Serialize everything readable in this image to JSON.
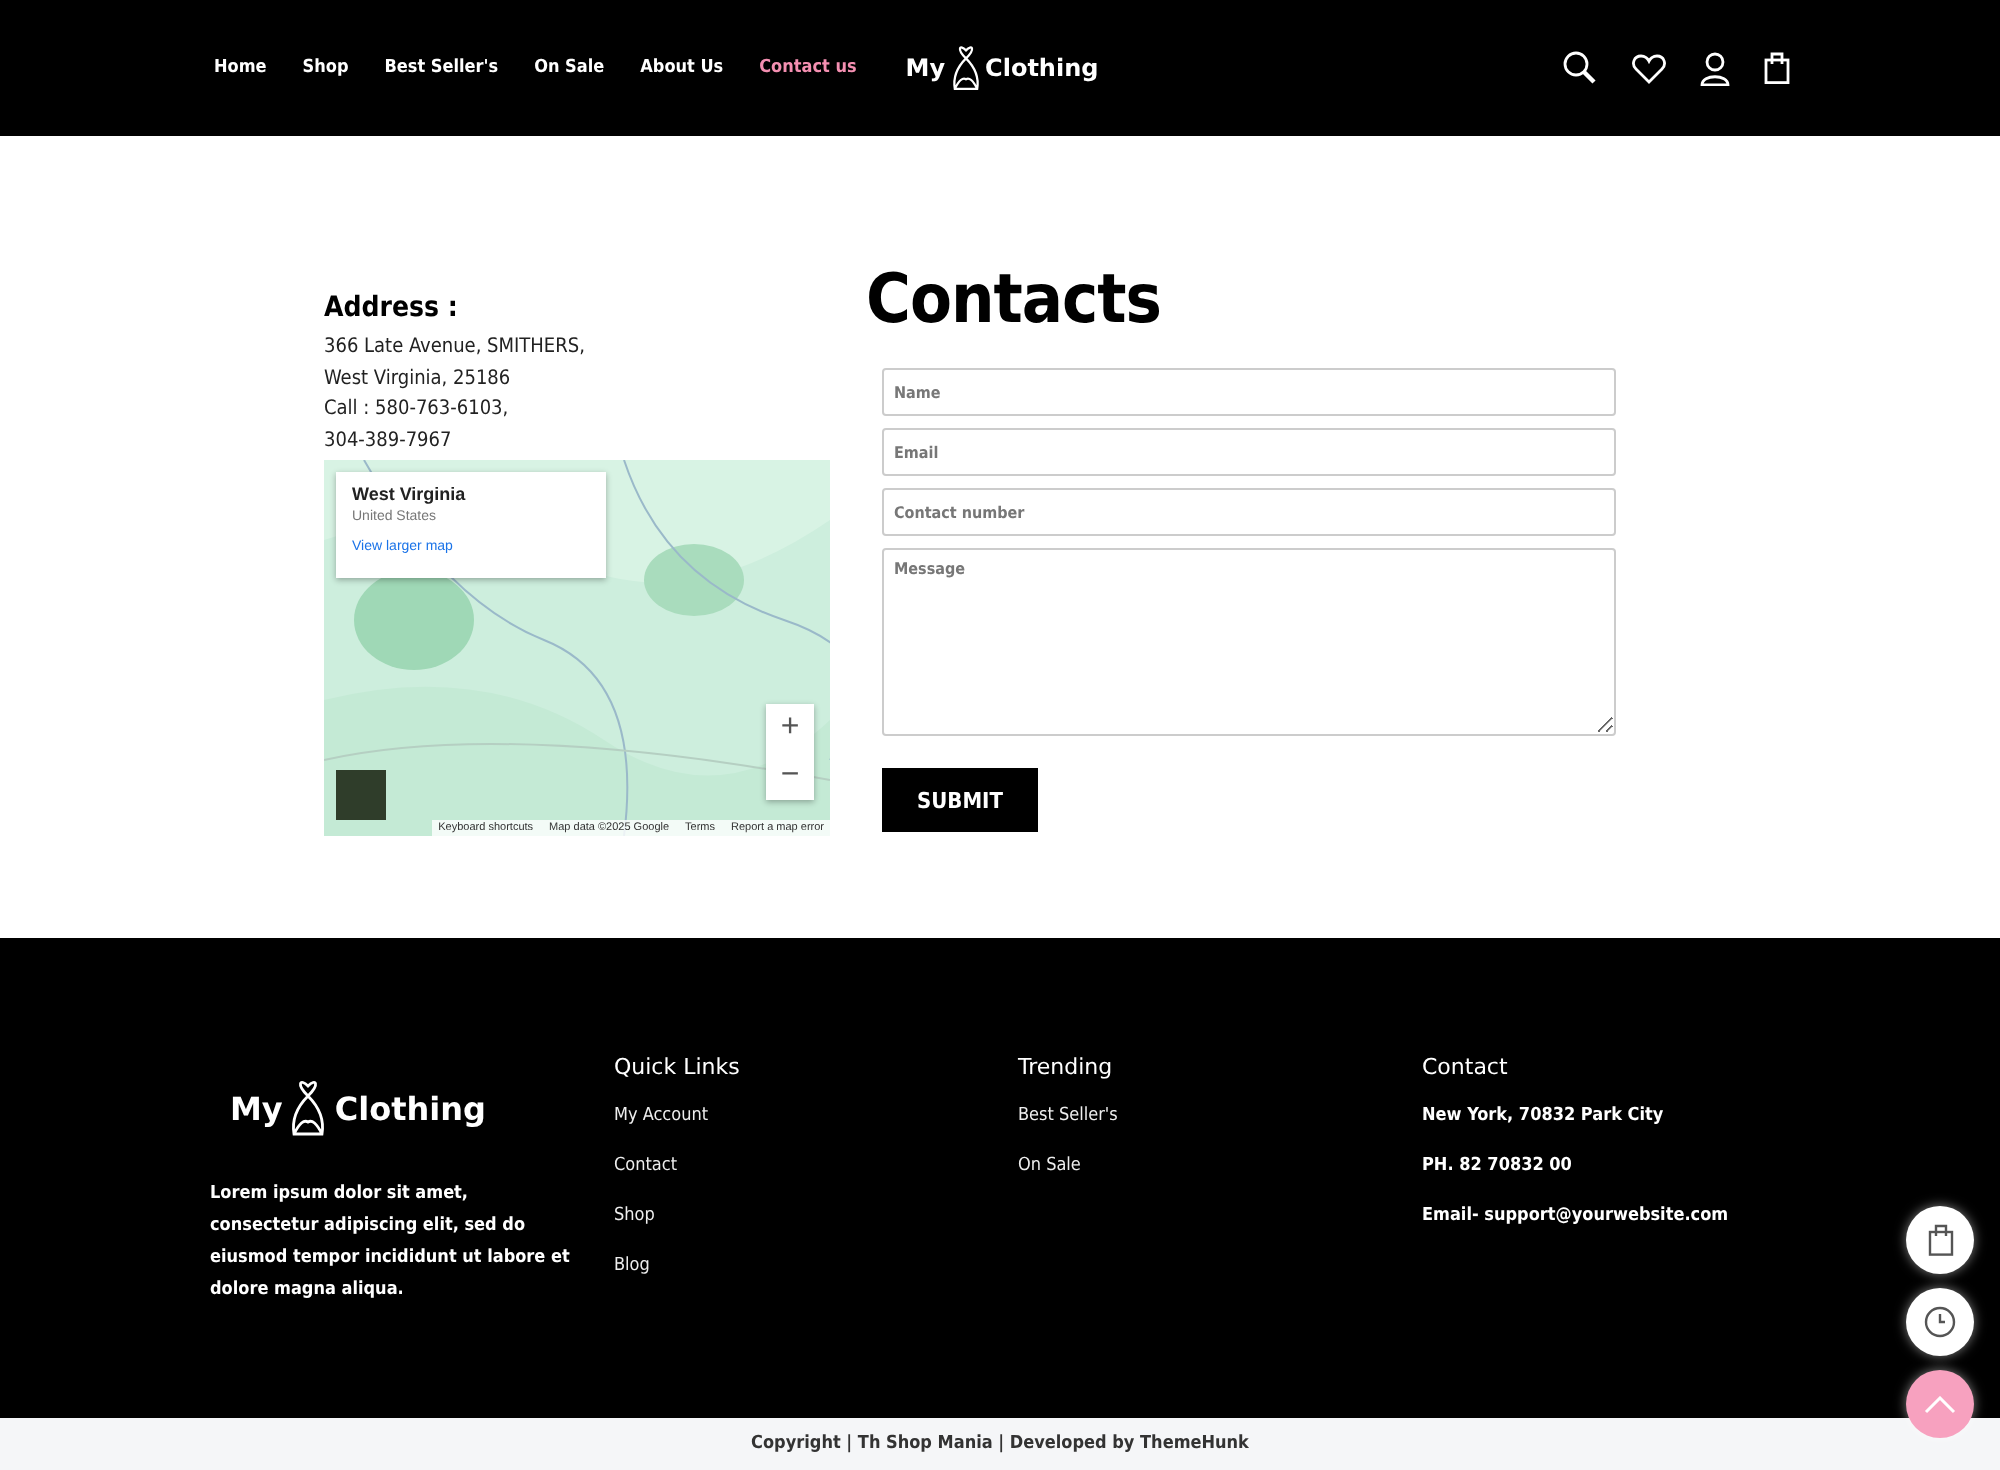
{
  "nav": [
    {
      "label": "Home",
      "selected": false
    },
    {
      "label": "Shop",
      "selected": false
    },
    {
      "label": "Best Seller's",
      "selected": false
    },
    {
      "label": "On Sale",
      "selected": false
    },
    {
      "label": "About Us",
      "selected": false
    },
    {
      "label": "Contact us",
      "selected": true
    }
  ],
  "logo": {
    "left": "My",
    "right": "Clothing"
  },
  "address": {
    "heading": "Address :",
    "lines": [
      " 366 Late Avenue, SMITHERS,",
      "West Virginia, 25186",
      "Call : 580-763-6103,",
      "304-389-7967"
    ]
  },
  "map": {
    "kind": "picture",
    "card_title": "West Virginia",
    "card_subtitle": "United States",
    "card_link": "View larger map",
    "zoom_in": "+",
    "zoom_out": "−",
    "attribution": [
      "Keyboard shortcuts",
      "Map data ©2025 Google",
      "Terms",
      "Report a map error"
    ]
  },
  "form": {
    "title": "Contacts",
    "fields": [
      {
        "placeholder": "Name",
        "kind": "input"
      },
      {
        "placeholder": "Email",
        "kind": "input"
      },
      {
        "placeholder": "Contact number",
        "kind": "input"
      },
      {
        "placeholder": "Message",
        "kind": "textarea"
      }
    ],
    "submit": "SUBMIT"
  },
  "footer": {
    "logo": {
      "left": "My",
      "right": "Clothing"
    },
    "about": "Lorem ipsum dolor sit amet, consectetur adipiscing elit, sed do eiusmod tempor incididunt ut labore et dolore magna aliqua.",
    "columns": [
      {
        "title": "Quick Links",
        "links": [
          "My Account",
          "Contact",
          "Shop",
          "Blog"
        ]
      },
      {
        "title": "Trending",
        "links": [
          "Best Seller's",
          "On Sale"
        ]
      },
      {
        "title": "Contact",
        "links": [
          "New York, 70832 Park City",
          "PH. 82 70832 00",
          "Email- support@yourwebsite.com"
        ]
      }
    ]
  },
  "copyright": "Copyright | Th Shop Mania | Developed by ThemeHunk"
}
